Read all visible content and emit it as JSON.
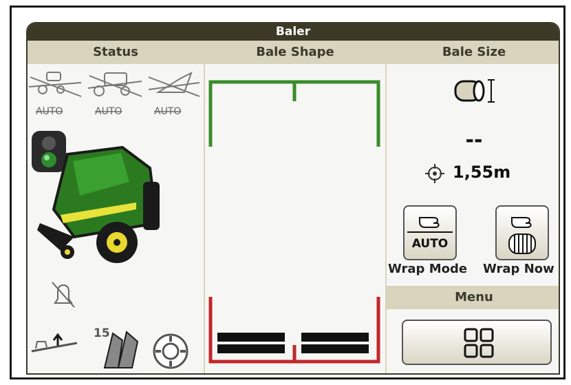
{
  "header": {
    "title": "Baler"
  },
  "columns": {
    "status": "Status",
    "bale_shape": "Bale Shape",
    "bale_size": "Bale Size"
  },
  "status": {
    "auto_labels": [
      "AUTO",
      "AUTO",
      "AUTO"
    ],
    "knife_count": "15",
    "indicator_color": "#2e8b2e"
  },
  "bale_size": {
    "target_value": "--",
    "diameter_value": "1,55m"
  },
  "buttons": {
    "wrap_mode_badge": "AUTO",
    "wrap_mode_label": "Wrap Mode",
    "wrap_now_label": "Wrap Now"
  },
  "menu": {
    "label": "Menu"
  },
  "colors": {
    "accent_green": "#3a8c2a",
    "alert_red": "#c0282d",
    "header_dark": "#3c3a26",
    "header_light": "#d8d4bd"
  }
}
